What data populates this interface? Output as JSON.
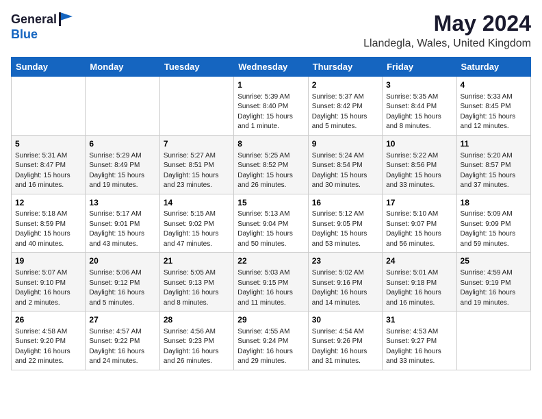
{
  "header": {
    "logo_general": "General",
    "logo_blue": "Blue",
    "month": "May 2024",
    "location": "Llandegla, Wales, United Kingdom"
  },
  "weekdays": [
    "Sunday",
    "Monday",
    "Tuesday",
    "Wednesday",
    "Thursday",
    "Friday",
    "Saturday"
  ],
  "weeks": [
    [
      {
        "day": "",
        "info": ""
      },
      {
        "day": "",
        "info": ""
      },
      {
        "day": "",
        "info": ""
      },
      {
        "day": "1",
        "info": "Sunrise: 5:39 AM\nSunset: 8:40 PM\nDaylight: 15 hours\nand 1 minute."
      },
      {
        "day": "2",
        "info": "Sunrise: 5:37 AM\nSunset: 8:42 PM\nDaylight: 15 hours\nand 5 minutes."
      },
      {
        "day": "3",
        "info": "Sunrise: 5:35 AM\nSunset: 8:44 PM\nDaylight: 15 hours\nand 8 minutes."
      },
      {
        "day": "4",
        "info": "Sunrise: 5:33 AM\nSunset: 8:45 PM\nDaylight: 15 hours\nand 12 minutes."
      }
    ],
    [
      {
        "day": "5",
        "info": "Sunrise: 5:31 AM\nSunset: 8:47 PM\nDaylight: 15 hours\nand 16 minutes."
      },
      {
        "day": "6",
        "info": "Sunrise: 5:29 AM\nSunset: 8:49 PM\nDaylight: 15 hours\nand 19 minutes."
      },
      {
        "day": "7",
        "info": "Sunrise: 5:27 AM\nSunset: 8:51 PM\nDaylight: 15 hours\nand 23 minutes."
      },
      {
        "day": "8",
        "info": "Sunrise: 5:25 AM\nSunset: 8:52 PM\nDaylight: 15 hours\nand 26 minutes."
      },
      {
        "day": "9",
        "info": "Sunrise: 5:24 AM\nSunset: 8:54 PM\nDaylight: 15 hours\nand 30 minutes."
      },
      {
        "day": "10",
        "info": "Sunrise: 5:22 AM\nSunset: 8:56 PM\nDaylight: 15 hours\nand 33 minutes."
      },
      {
        "day": "11",
        "info": "Sunrise: 5:20 AM\nSunset: 8:57 PM\nDaylight: 15 hours\nand 37 minutes."
      }
    ],
    [
      {
        "day": "12",
        "info": "Sunrise: 5:18 AM\nSunset: 8:59 PM\nDaylight: 15 hours\nand 40 minutes."
      },
      {
        "day": "13",
        "info": "Sunrise: 5:17 AM\nSunset: 9:01 PM\nDaylight: 15 hours\nand 43 minutes."
      },
      {
        "day": "14",
        "info": "Sunrise: 5:15 AM\nSunset: 9:02 PM\nDaylight: 15 hours\nand 47 minutes."
      },
      {
        "day": "15",
        "info": "Sunrise: 5:13 AM\nSunset: 9:04 PM\nDaylight: 15 hours\nand 50 minutes."
      },
      {
        "day": "16",
        "info": "Sunrise: 5:12 AM\nSunset: 9:05 PM\nDaylight: 15 hours\nand 53 minutes."
      },
      {
        "day": "17",
        "info": "Sunrise: 5:10 AM\nSunset: 9:07 PM\nDaylight: 15 hours\nand 56 minutes."
      },
      {
        "day": "18",
        "info": "Sunrise: 5:09 AM\nSunset: 9:09 PM\nDaylight: 15 hours\nand 59 minutes."
      }
    ],
    [
      {
        "day": "19",
        "info": "Sunrise: 5:07 AM\nSunset: 9:10 PM\nDaylight: 16 hours\nand 2 minutes."
      },
      {
        "day": "20",
        "info": "Sunrise: 5:06 AM\nSunset: 9:12 PM\nDaylight: 16 hours\nand 5 minutes."
      },
      {
        "day": "21",
        "info": "Sunrise: 5:05 AM\nSunset: 9:13 PM\nDaylight: 16 hours\nand 8 minutes."
      },
      {
        "day": "22",
        "info": "Sunrise: 5:03 AM\nSunset: 9:15 PM\nDaylight: 16 hours\nand 11 minutes."
      },
      {
        "day": "23",
        "info": "Sunrise: 5:02 AM\nSunset: 9:16 PM\nDaylight: 16 hours\nand 14 minutes."
      },
      {
        "day": "24",
        "info": "Sunrise: 5:01 AM\nSunset: 9:18 PM\nDaylight: 16 hours\nand 16 minutes."
      },
      {
        "day": "25",
        "info": "Sunrise: 4:59 AM\nSunset: 9:19 PM\nDaylight: 16 hours\nand 19 minutes."
      }
    ],
    [
      {
        "day": "26",
        "info": "Sunrise: 4:58 AM\nSunset: 9:20 PM\nDaylight: 16 hours\nand 22 minutes."
      },
      {
        "day": "27",
        "info": "Sunrise: 4:57 AM\nSunset: 9:22 PM\nDaylight: 16 hours\nand 24 minutes."
      },
      {
        "day": "28",
        "info": "Sunrise: 4:56 AM\nSunset: 9:23 PM\nDaylight: 16 hours\nand 26 minutes."
      },
      {
        "day": "29",
        "info": "Sunrise: 4:55 AM\nSunset: 9:24 PM\nDaylight: 16 hours\nand 29 minutes."
      },
      {
        "day": "30",
        "info": "Sunrise: 4:54 AM\nSunset: 9:26 PM\nDaylight: 16 hours\nand 31 minutes."
      },
      {
        "day": "31",
        "info": "Sunrise: 4:53 AM\nSunset: 9:27 PM\nDaylight: 16 hours\nand 33 minutes."
      },
      {
        "day": "",
        "info": ""
      }
    ]
  ]
}
